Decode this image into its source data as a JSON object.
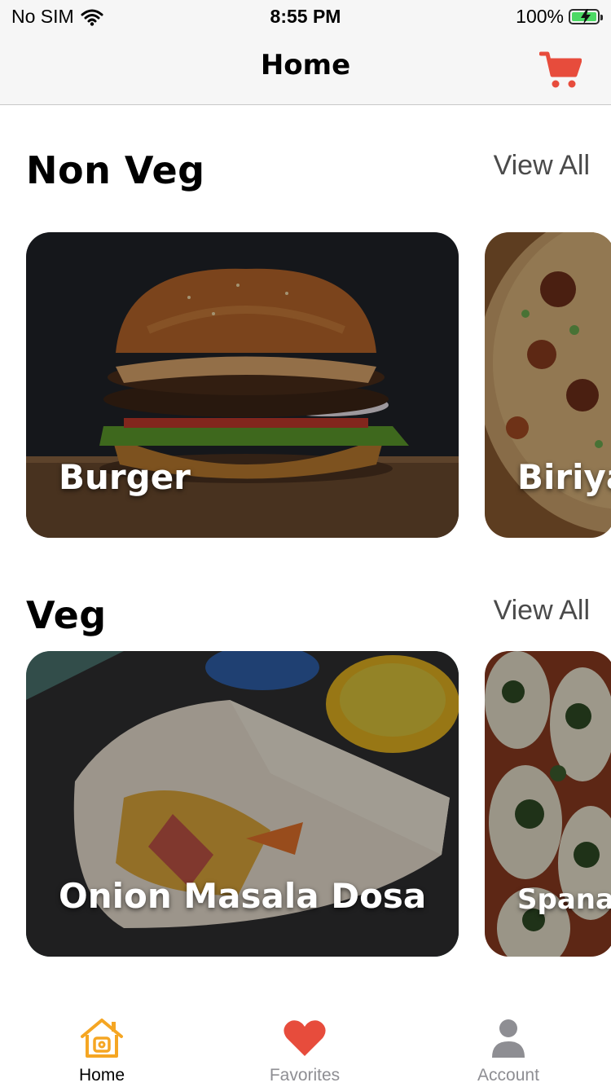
{
  "status_bar": {
    "carrier": "No SIM",
    "time": "8:55 PM",
    "battery": "100%"
  },
  "nav": {
    "title": "Home",
    "cart_icon": "cart-icon"
  },
  "sections": [
    {
      "title": "Non Veg",
      "view_all": "View All",
      "cards": [
        {
          "label": "Burger"
        },
        {
          "label": "Biriya"
        }
      ]
    },
    {
      "title": "Veg",
      "view_all": "View All",
      "cards": [
        {
          "label": "Onion Masala Dosa"
        },
        {
          "label": "Spanak"
        }
      ]
    }
  ],
  "tabs": [
    {
      "label": "Home",
      "icon": "home-icon",
      "active": true
    },
    {
      "label": "Favorites",
      "icon": "heart-icon",
      "active": false
    },
    {
      "label": "Account",
      "icon": "person-icon",
      "active": false
    }
  ],
  "colors": {
    "accent": "#e74c3c",
    "home_icon": "#f5a623"
  }
}
